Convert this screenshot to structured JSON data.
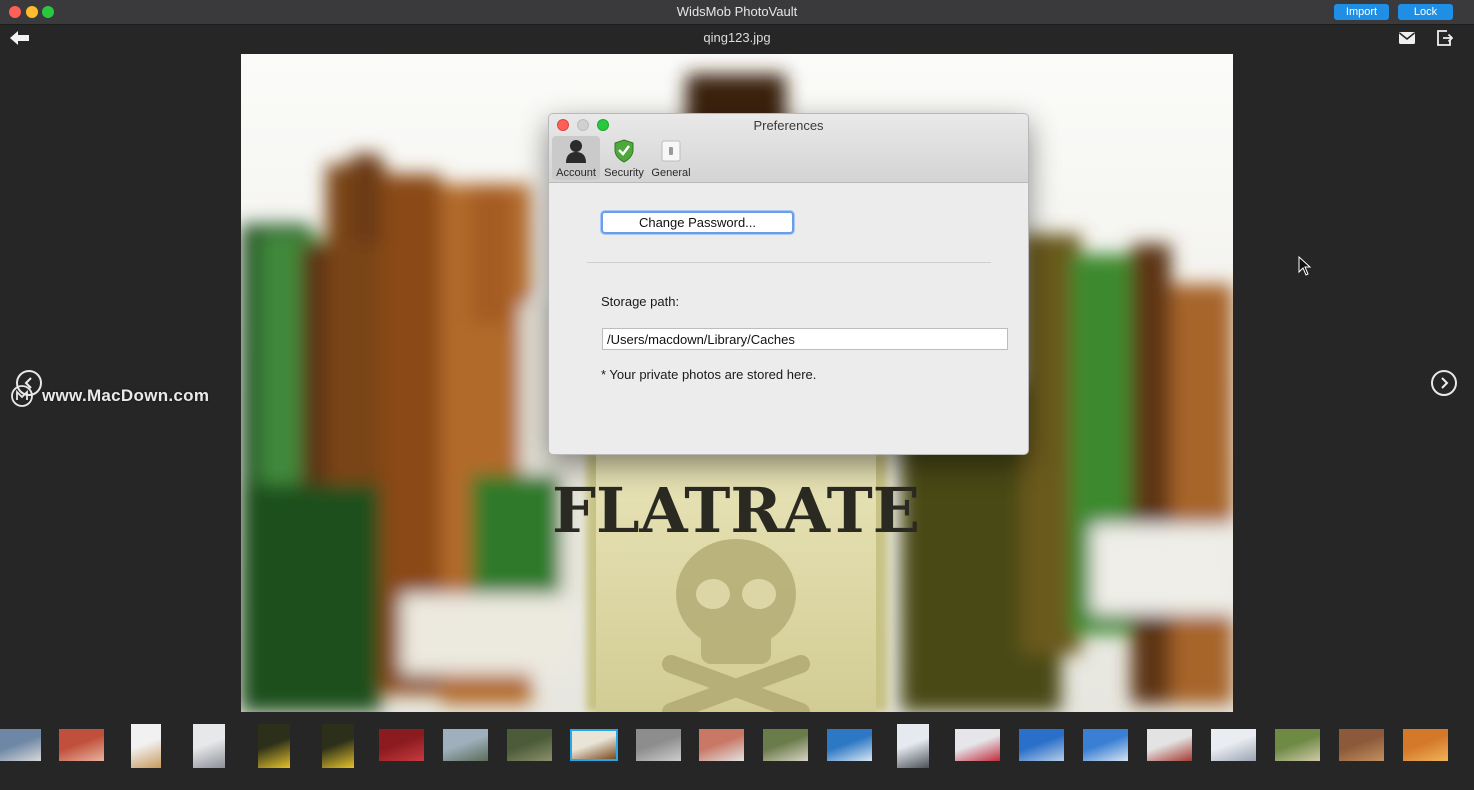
{
  "app": {
    "title": "WidsMob PhotoVault",
    "import_label": "Import",
    "lock_label": "Lock",
    "accent_color": "#1f8fe6"
  },
  "viewer": {
    "file_name": "qing123.jpg",
    "photo_label_text": "FLATRATE",
    "watermark": "www.MacDown.com"
  },
  "preferences": {
    "title": "Preferences",
    "tabs": [
      {
        "label": "Account",
        "icon": "account-silhouette-icon"
      },
      {
        "label": "Security",
        "icon": "shield-check-icon"
      },
      {
        "label": "General",
        "icon": "general-switch-icon"
      }
    ],
    "change_password_label": "Change Password...",
    "storage_label": "Storage path:",
    "storage_path": "/Users/macdown/Library/Caches",
    "storage_note": "* Your private photos are stored here."
  },
  "thumbnails": [
    {
      "name": "harbor-city",
      "colors": [
        "#6e87a6",
        "#d8d8d8"
      ]
    },
    {
      "name": "red-flowers",
      "colors": [
        "#c0503b",
        "#e8b3a0"
      ]
    },
    {
      "name": "giraffe",
      "colors": [
        "#f1f1f1",
        "#c89a5e"
      ]
    },
    {
      "name": "snowy-buildings",
      "colors": [
        "#e7e8ea",
        "#8c9098"
      ]
    },
    {
      "name": "road-sign-1",
      "colors": [
        "#2c2f1a",
        "#e4c22a"
      ]
    },
    {
      "name": "road-sign-2",
      "colors": [
        "#2c2f1a",
        "#e4c22a"
      ]
    },
    {
      "name": "red-berries",
      "colors": [
        "#8c1b1f",
        "#c63b3f"
      ]
    },
    {
      "name": "river-bridge",
      "colors": [
        "#9fb0bc",
        "#5c6c5a"
      ]
    },
    {
      "name": "forest-trail",
      "colors": [
        "#4c5b3a",
        "#8a8f6a"
      ]
    },
    {
      "name": "bottles",
      "colors": [
        "#e9e4d6",
        "#7a4a1e"
      ],
      "selected": true
    },
    {
      "name": "street-scene",
      "colors": [
        "#8d8d8d",
        "#cdcdcd"
      ]
    },
    {
      "name": "crowd-signs",
      "colors": [
        "#c97866",
        "#e2e2e2"
      ]
    },
    {
      "name": "house-garden",
      "colors": [
        "#6b7c4b",
        "#d8d3c3"
      ]
    },
    {
      "name": "beach-palm",
      "colors": [
        "#2d78c4",
        "#d7e6f3"
      ]
    },
    {
      "name": "tower-building",
      "colors": [
        "#e6eaf0",
        "#4b4f58"
      ]
    },
    {
      "name": "desk-items",
      "colors": [
        "#e5e5ea",
        "#c02c3a"
      ]
    },
    {
      "name": "blue-sky-field",
      "colors": [
        "#2a6fc9",
        "#b7cde8"
      ]
    },
    {
      "name": "sky-clouds",
      "colors": [
        "#3a7fd3",
        "#d5e3f2"
      ]
    },
    {
      "name": "red-building",
      "colors": [
        "#e3e3e3",
        "#a63a32"
      ]
    },
    {
      "name": "snowy-tree",
      "colors": [
        "#e9ecf1",
        "#9aa4b2"
      ]
    },
    {
      "name": "park-path",
      "colors": [
        "#6f8a45",
        "#cfc9a8"
      ]
    },
    {
      "name": "brick-wall",
      "colors": [
        "#8c5a3a",
        "#c2915e"
      ]
    },
    {
      "name": "desert-dunes",
      "colors": [
        "#d4782a",
        "#f0b457"
      ]
    }
  ]
}
